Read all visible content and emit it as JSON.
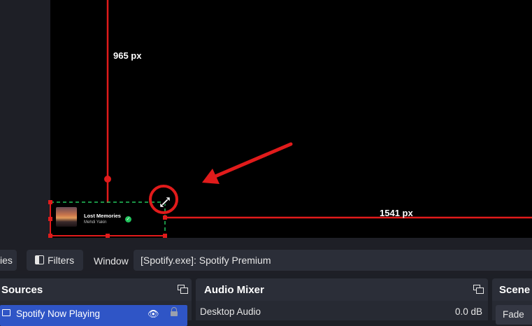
{
  "preview": {
    "height_measure": "965 px",
    "width_measure": "1541 px",
    "source_card": {
      "title": "Lost Memories",
      "artist": "Mehdi Yakin"
    },
    "colors": {
      "measure_line": "#e11b1b",
      "bounding_dash": "#22c55e",
      "annotation": "#e11b1b"
    }
  },
  "toolbar": {
    "properties_label": "ies",
    "filters_label": "Filters",
    "window_label": "Window",
    "window_value": "[Spotify.exe]: Spotify Premium"
  },
  "sources": {
    "title": "Sources",
    "items": [
      {
        "label": "Spotify Now Playing"
      }
    ]
  },
  "audio_mixer": {
    "title": "Audio Mixer",
    "channels": [
      {
        "name": "Desktop Audio",
        "level": "0.0 dB"
      }
    ]
  },
  "scene_transitions": {
    "title": "Scene T",
    "transition": "Fade"
  }
}
